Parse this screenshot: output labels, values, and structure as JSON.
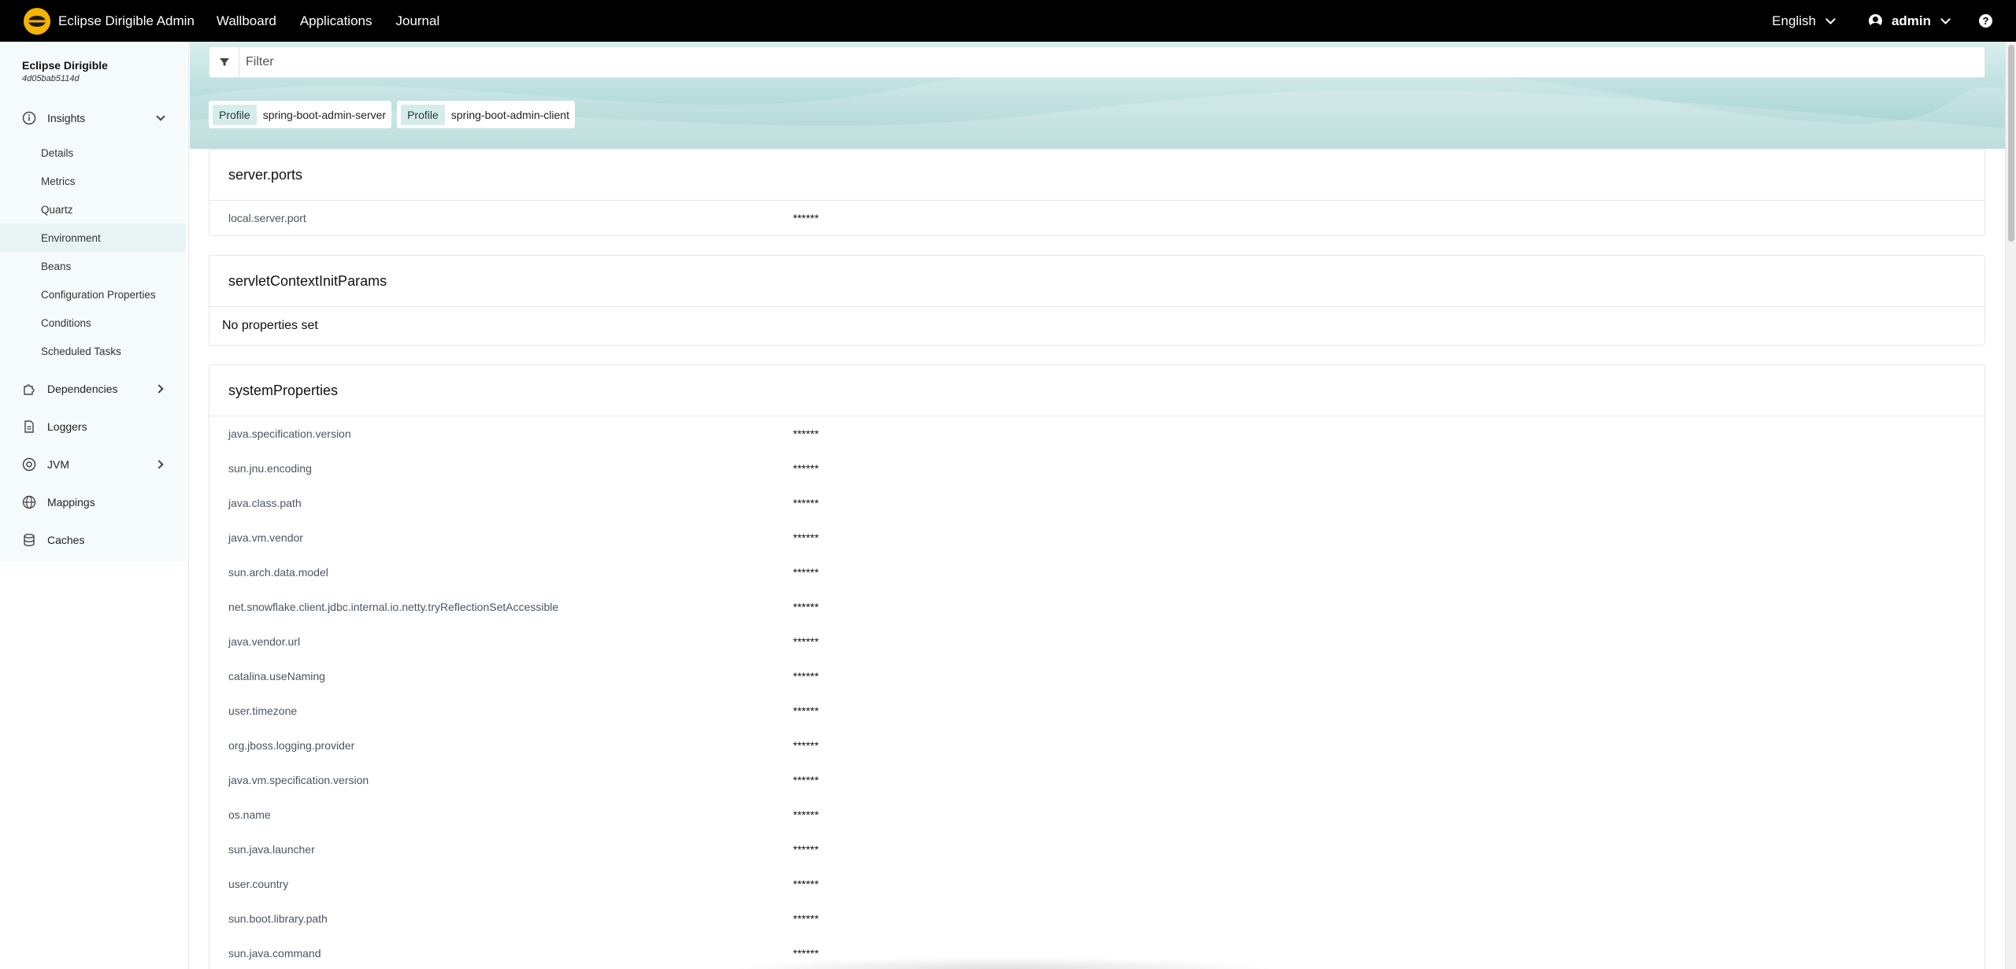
{
  "topbar": {
    "brand": "Eclipse Dirigible Admin",
    "nav": [
      "Wallboard",
      "Applications",
      "Journal"
    ],
    "language": "English",
    "user": "admin"
  },
  "sidebar": {
    "app_name": "Eclipse Dirigible",
    "instance_id": "4d05bab5114d",
    "insights": {
      "label": "Insights",
      "items": [
        "Details",
        "Metrics",
        "Quartz",
        "Environment",
        "Beans",
        "Configuration Properties",
        "Conditions",
        "Scheduled Tasks"
      ],
      "active": "Environment"
    },
    "items": [
      {
        "label": "Dependencies",
        "icon": "puzzle-icon",
        "expandable": true
      },
      {
        "label": "Loggers",
        "icon": "document-icon",
        "expandable": false
      },
      {
        "label": "JVM",
        "icon": "jvm-icon",
        "expandable": true
      },
      {
        "label": "Mappings",
        "icon": "globe-icon",
        "expandable": false
      },
      {
        "label": "Caches",
        "icon": "database-icon",
        "expandable": false
      }
    ]
  },
  "filter": {
    "placeholder": "Filter"
  },
  "profiles": [
    {
      "key": "Profile",
      "value": "spring-boot-admin-server"
    },
    {
      "key": "Profile",
      "value": "spring-boot-admin-client"
    }
  ],
  "sections": {
    "server_ports": {
      "title": "server.ports",
      "rows": [
        {
          "key": "local.server.port",
          "value": "******"
        }
      ]
    },
    "servlet_context": {
      "title": "servletContextInitParams",
      "empty_text": "No properties set"
    },
    "system_properties": {
      "title": "systemProperties",
      "rows": [
        {
          "key": "java.specification.version",
          "value": "******"
        },
        {
          "key": "sun.jnu.encoding",
          "value": "******"
        },
        {
          "key": "java.class.path",
          "value": "******"
        },
        {
          "key": "java.vm.vendor",
          "value": "******"
        },
        {
          "key": "sun.arch.data.model",
          "value": "******"
        },
        {
          "key": "net.snowflake.client.jdbc.internal.io.netty.tryReflectionSetAccessible",
          "value": "******"
        },
        {
          "key": "java.vendor.url",
          "value": "******"
        },
        {
          "key": "catalina.useNaming",
          "value": "******"
        },
        {
          "key": "user.timezone",
          "value": "******"
        },
        {
          "key": "org.jboss.logging.provider",
          "value": "******"
        },
        {
          "key": "java.vm.specification.version",
          "value": "******"
        },
        {
          "key": "os.name",
          "value": "******"
        },
        {
          "key": "sun.java.launcher",
          "value": "******"
        },
        {
          "key": "user.country",
          "value": "******"
        },
        {
          "key": "sun.boot.library.path",
          "value": "******"
        },
        {
          "key": "sun.java.command",
          "value": "******"
        }
      ]
    }
  },
  "colors": {
    "topbar": "#000000",
    "brand_logo": "#f5b400",
    "sidebar_bg": "#f5fbfb",
    "active_item": "#e8f4f4",
    "hero": "#b6dcdb",
    "profile_key_bg": "#d6ecea"
  }
}
